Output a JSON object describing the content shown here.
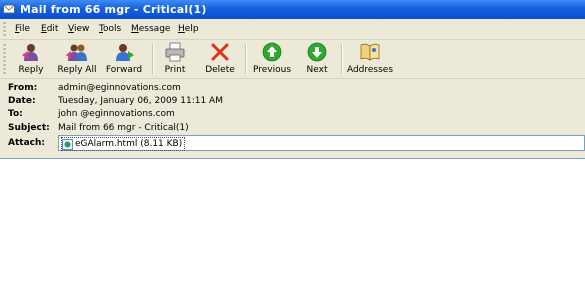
{
  "window": {
    "title": "Mail from 66 mgr -  Critical(1)"
  },
  "menu": {
    "file_key": "F",
    "file_rest": "ile",
    "edit_key": "E",
    "edit_rest": "dit",
    "view_key": "V",
    "view_rest": "iew",
    "tools_key": "T",
    "tools_rest": "ools",
    "message_key": "M",
    "message_rest": "essage",
    "help_key": "H",
    "help_rest": "elp"
  },
  "toolbar": {
    "reply": "Reply",
    "reply_all": "Reply All",
    "forward": "Forward",
    "print": "Print",
    "delete": "Delete",
    "previous": "Previous",
    "next": "Next",
    "addresses": "Addresses"
  },
  "header": {
    "from_label": "From:",
    "from_value": "admin@eginnovations.com",
    "date_label": "Date:",
    "date_value": "Tuesday, January 06, 2009 11:11 AM",
    "to_label": "To:",
    "to_value": "john @eginnovations.com",
    "subject_label": "Subject:",
    "subject_value": "Mail from 66 mgr -  Critical(1)",
    "attach_label": "Attach:",
    "attachment": "eGAlarm.html (8.11 KB)"
  },
  "colors": {
    "titlebar": "#0A4FD1",
    "chrome": "#ECE9D8",
    "delete_red": "#E0321C",
    "nav_green": "#2FA82F"
  },
  "icons": {
    "reply": "reply-icon",
    "reply_all": "reply-all-icon",
    "forward": "forward-icon",
    "print": "printer-icon",
    "delete": "delete-x-icon",
    "previous": "up-arrow-icon",
    "next": "down-arrow-icon",
    "addresses": "address-book-icon"
  }
}
